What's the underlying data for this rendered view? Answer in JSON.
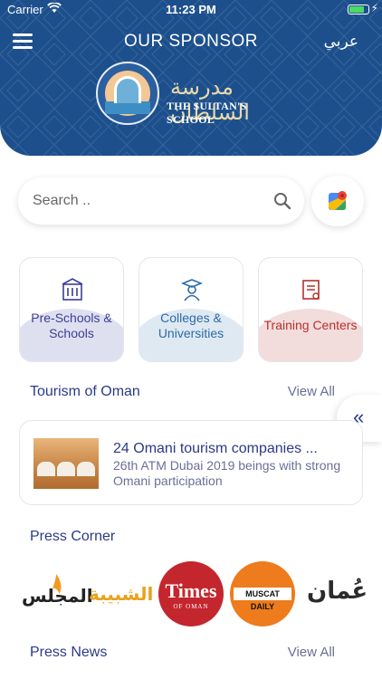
{
  "status_bar": {
    "carrier": "Carrier",
    "time": "11:23 PM",
    "battery_level": 0.85
  },
  "header": {
    "title": "OUR SPONSOR",
    "language_toggle": "عربي"
  },
  "sponsor": {
    "name_arabic": "مدرسة السلطان",
    "name_english": "THE SULTAN'S SCHOOL"
  },
  "search": {
    "placeholder": "Search .."
  },
  "categories": [
    {
      "label": "Pre-Schools & Schools",
      "icon": "school-building-icon"
    },
    {
      "label": "Colleges & Universities",
      "icon": "graduate-icon"
    },
    {
      "label": "Training Centers",
      "icon": "certificate-icon"
    }
  ],
  "tourism": {
    "title": "Tourism of Oman",
    "view_all": "View All",
    "item": {
      "title": "24 Omani tourism companies ...",
      "subtitle": "26th ATM Dubai 2019 beings with strong Omani participation"
    }
  },
  "press_corner": {
    "title": "Press Corner",
    "logos": [
      {
        "text": "المجلس"
      },
      {
        "text": "الشبيبة"
      },
      {
        "text": "Times",
        "sub": "OF OMAN"
      },
      {
        "text": "MUSCAT DAILY"
      },
      {
        "text": "عُمان"
      }
    ]
  },
  "press_news": {
    "title": "Press News",
    "view_all": "View All"
  },
  "colors": {
    "header_blue": "#1c4f8c",
    "text_blue": "#2b3a88",
    "accent_red": "#b4322f"
  }
}
